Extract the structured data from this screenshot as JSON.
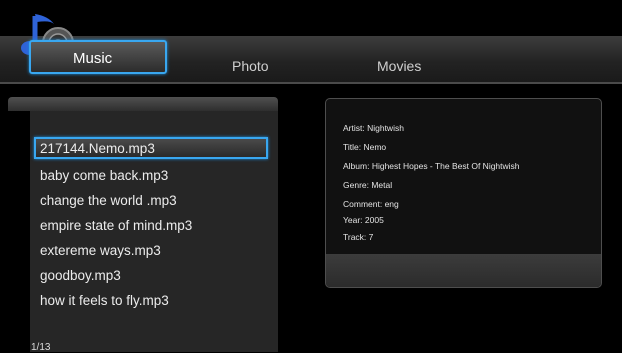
{
  "tabs": [
    {
      "label": "Music",
      "active": true
    },
    {
      "label": "Photo",
      "active": false
    },
    {
      "label": "Movies",
      "active": false
    }
  ],
  "file_list": {
    "items": [
      "217144.Nemo.mp3",
      "baby come back.mp3",
      "change the world .mp3",
      "empire state of mind.mp3",
      "extereme ways.mp3",
      "goodboy.mp3",
      "how it feels to fly.mp3"
    ],
    "selected_index": 0,
    "page_indicator": "1/13"
  },
  "info": {
    "artist": "Artist: Nightwish",
    "title": "Title: Nemo",
    "album": "Album: Highest Hopes - The Best Of Nightwish",
    "genre": "Genre: Metal",
    "comment": "Comment: eng",
    "year": "Year: 2005",
    "track": "Track: 7"
  },
  "icons": {
    "music": "music-note-speaker-icon"
  },
  "colors": {
    "accent": "#39a7f0",
    "background": "#000000"
  }
}
